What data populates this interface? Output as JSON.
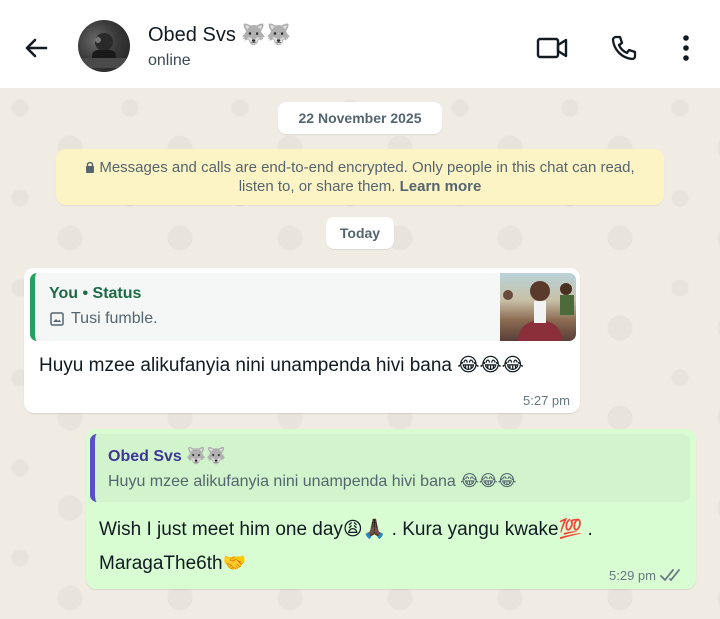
{
  "header": {
    "contact_name": "Obed Svs 🐺🐺",
    "contact_status": "online",
    "icons": [
      "back-arrow-icon",
      "video-call-icon",
      "voice-call-icon",
      "more-options-icon"
    ]
  },
  "chat": {
    "date_chip": "22 November 2025",
    "encryption_notice": {
      "text": "Messages and calls are end-to-end encrypted. Only people in this chat can read, listen to, or share them.",
      "link": "Learn more"
    },
    "today_chip": "Today",
    "messages": [
      {
        "direction": "incoming",
        "quote": {
          "title": "You • Status",
          "text": "Tusi fumble."
        },
        "text": "Huyu mzee alikufanyia nini unampenda hivi bana 😂😂😂",
        "time": "5:27 pm"
      },
      {
        "direction": "outgoing",
        "quote": {
          "title": "Obed Svs 🐺🐺",
          "text": "Huyu mzee alikufanyia nini unampenda hivi bana 😂😂😂"
        },
        "text": "Wish I just meet him one day😩🙏🏿 . Kura yangu kwake💯 . MaragaThe6th🤝",
        "time": "5:29 pm",
        "read": true
      }
    ]
  },
  "colors": {
    "outgoing_bubble": "#d9fdd3",
    "incoming_bubble": "#ffffff",
    "encryption_bg": "#fdf4c5",
    "chat_bg": "#f0ebe3",
    "read_ticks": "#667781"
  }
}
